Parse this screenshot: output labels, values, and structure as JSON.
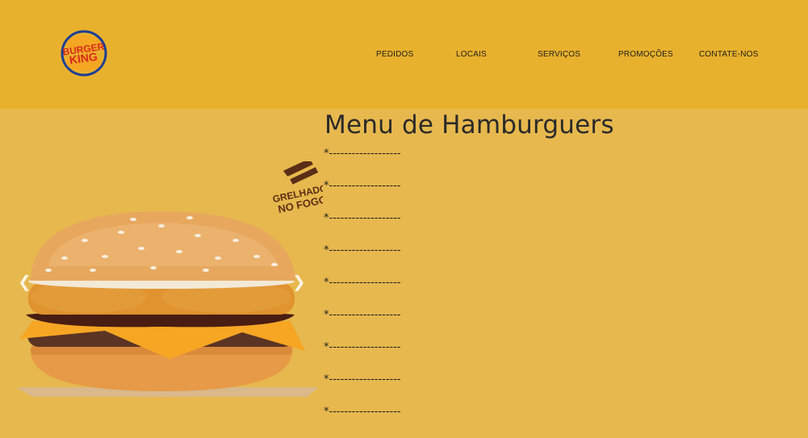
{
  "brand": {
    "logo_line1": "BURGER",
    "logo_line2": "KING"
  },
  "nav": {
    "items": [
      {
        "label": "PEDIDOS"
      },
      {
        "label": "LOCAIS"
      },
      {
        "label": "SERVIÇOS"
      },
      {
        "label": "PROMOÇÕES"
      },
      {
        "label": "CONTATE-NOS"
      }
    ]
  },
  "main": {
    "title": "Menu de Hamburguers",
    "items": [
      "*-------------------",
      "*-------------------",
      "*-------------------",
      "*-------------------",
      "*-------------------",
      "*-------------------",
      "*-------------------",
      "*-------------------",
      "*-------------------"
    ]
  },
  "carousel": {
    "badge_line1": "GRELHADO",
    "badge_line2": "NO FOGO",
    "prev_icon": "chevron-left-icon",
    "next_icon": "chevron-right-icon"
  },
  "colors": {
    "header_bg": "#e8b12d",
    "page_bg": "#e7b84d",
    "logo_blue": "#1c3f95",
    "logo_red": "#d52b1e",
    "logo_bun": "#f5a623"
  }
}
